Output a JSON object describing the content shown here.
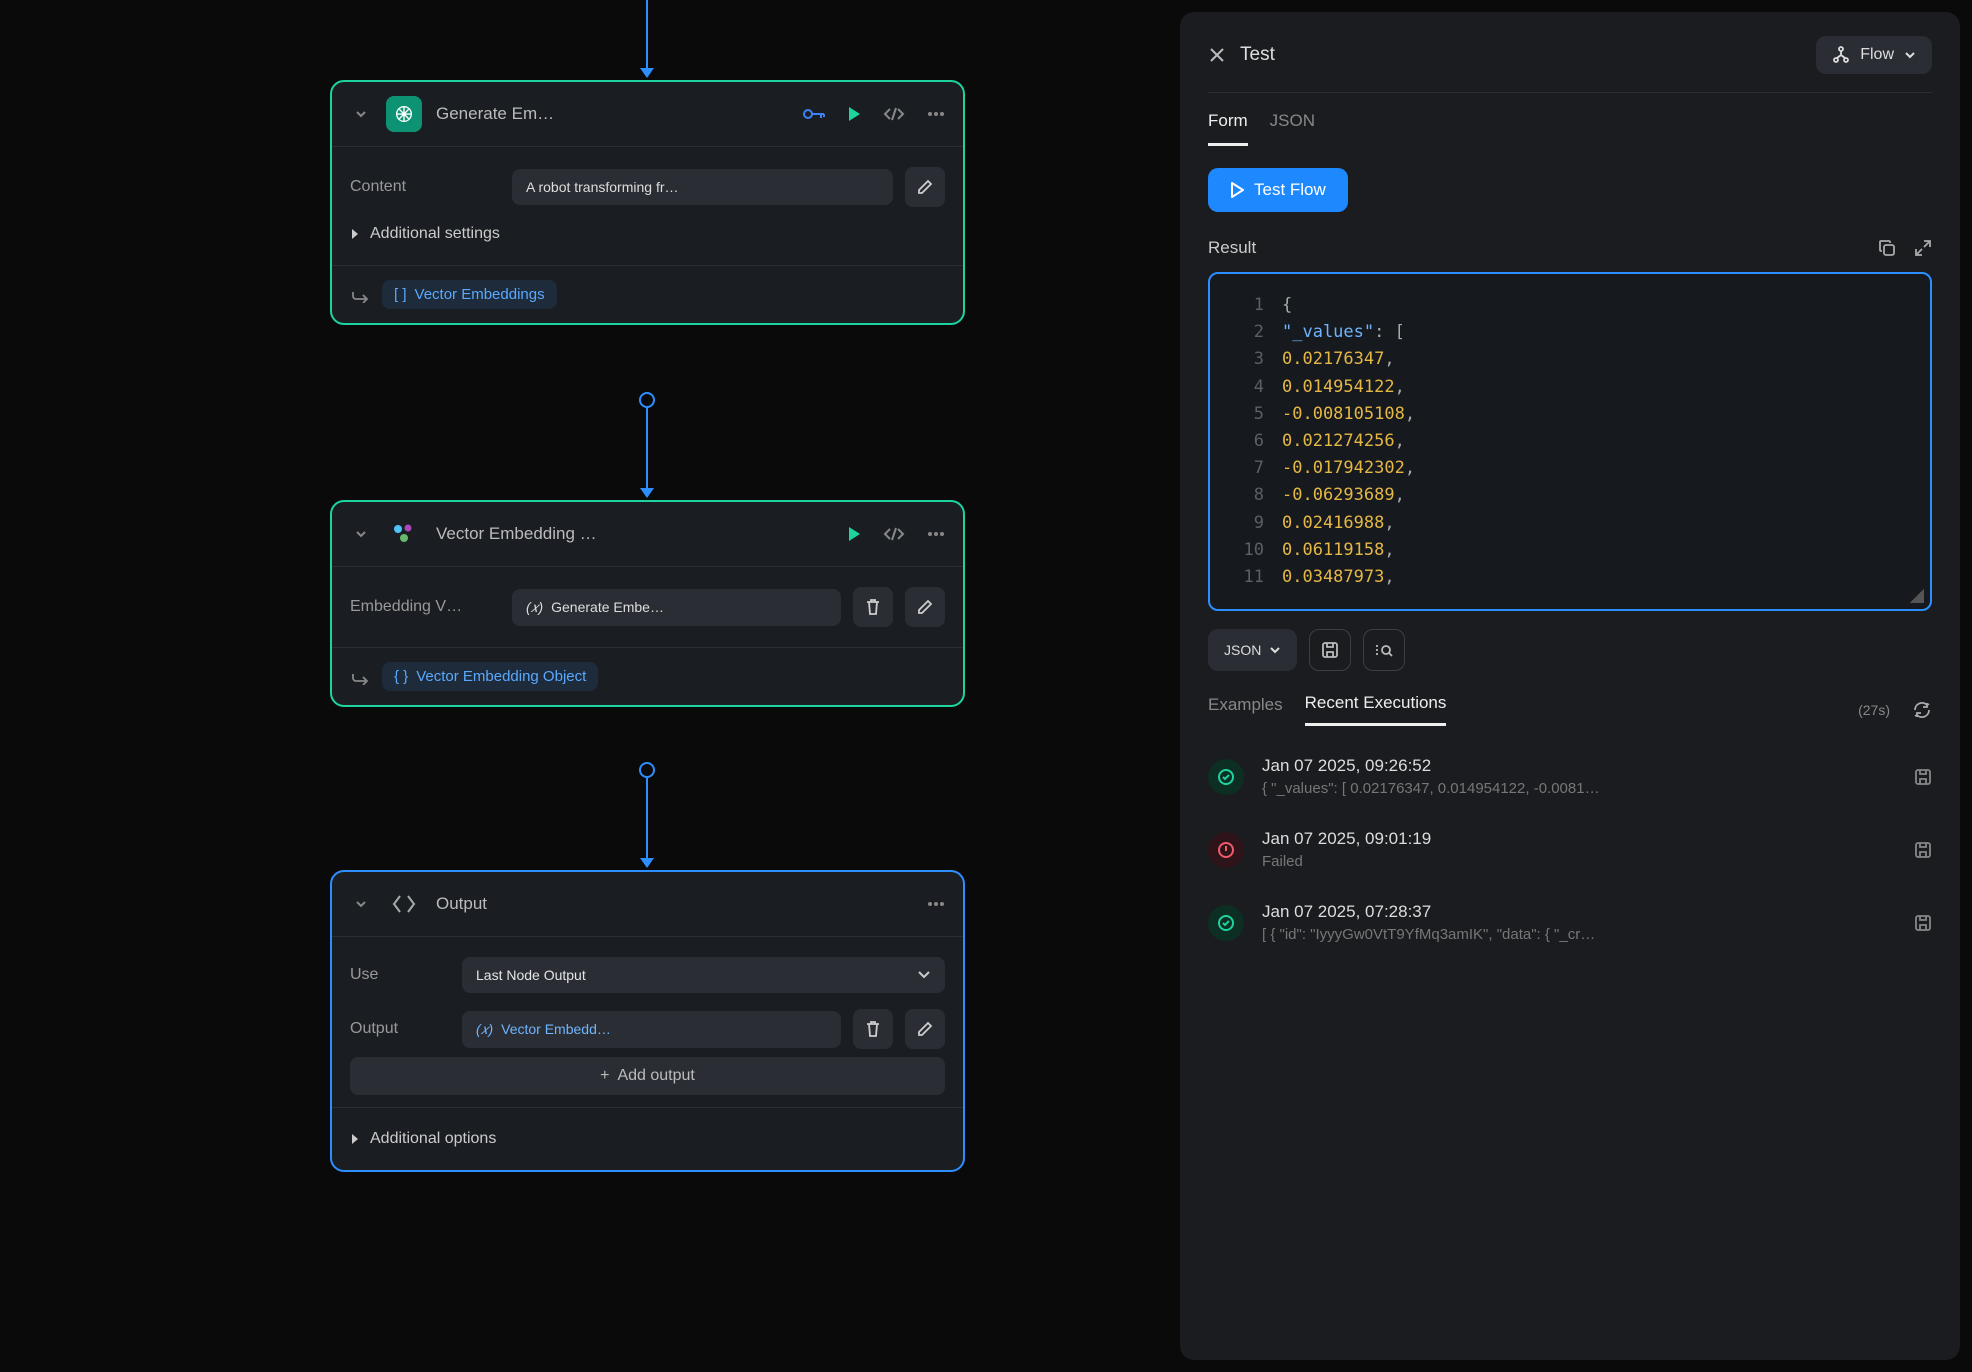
{
  "canvas": {
    "node1": {
      "title": "Generate Em…",
      "content_label": "Content",
      "content_value": "A robot transforming fr…",
      "additional": "Additional settings",
      "output_label": "Vector Embeddings"
    },
    "node2": {
      "title": "Vector Embedding …",
      "param_label": "Embedding V…",
      "param_value": "Generate Embe…",
      "output_label": "Vector Embedding Object"
    },
    "node3": {
      "title": "Output",
      "use_label": "Use",
      "use_value": "Last Node Output",
      "output_label": "Output",
      "output_value": "Vector Embedd…",
      "add_output": "Add output",
      "additional": "Additional options"
    }
  },
  "panel": {
    "title": "Test",
    "flow_btn": "Flow",
    "tabs": {
      "form": "Form",
      "json": "JSON"
    },
    "test_btn": "Test Flow",
    "result_label": "Result",
    "code": {
      "lines": [
        {
          "n": "1",
          "segs": [
            {
              "t": "{",
              "c": "punc"
            }
          ]
        },
        {
          "n": "2",
          "segs": [
            {
              "t": "  ",
              "c": "tok"
            },
            {
              "t": "\"_values\"",
              "c": "key-tok"
            },
            {
              "t": ": [",
              "c": "punc"
            }
          ]
        },
        {
          "n": "3",
          "segs": [
            {
              "t": "    ",
              "c": "tok"
            },
            {
              "t": "0.02176347",
              "c": "num-tok"
            },
            {
              "t": ",",
              "c": "punc"
            }
          ]
        },
        {
          "n": "4",
          "segs": [
            {
              "t": "    ",
              "c": "tok"
            },
            {
              "t": "0.014954122",
              "c": "num-tok"
            },
            {
              "t": ",",
              "c": "punc"
            }
          ]
        },
        {
          "n": "5",
          "segs": [
            {
              "t": "    ",
              "c": "tok"
            },
            {
              "t": "-0.008105108",
              "c": "num-tok"
            },
            {
              "t": ",",
              "c": "punc"
            }
          ]
        },
        {
          "n": "6",
          "segs": [
            {
              "t": "    ",
              "c": "tok"
            },
            {
              "t": "0.021274256",
              "c": "num-tok"
            },
            {
              "t": ",",
              "c": "punc"
            }
          ]
        },
        {
          "n": "7",
          "segs": [
            {
              "t": "    ",
              "c": "tok"
            },
            {
              "t": "-0.017942302",
              "c": "num-tok"
            },
            {
              "t": ",",
              "c": "punc"
            }
          ]
        },
        {
          "n": "8",
          "segs": [
            {
              "t": "    ",
              "c": "tok"
            },
            {
              "t": "-0.06293689",
              "c": "num-tok"
            },
            {
              "t": ",",
              "c": "punc"
            }
          ]
        },
        {
          "n": "9",
          "segs": [
            {
              "t": "    ",
              "c": "tok"
            },
            {
              "t": "0.02416988",
              "c": "num-tok"
            },
            {
              "t": ",",
              "c": "punc"
            }
          ]
        },
        {
          "n": "10",
          "segs": [
            {
              "t": "    ",
              "c": "tok"
            },
            {
              "t": "0.06119158",
              "c": "num-tok"
            },
            {
              "t": ",",
              "c": "punc"
            }
          ]
        },
        {
          "n": "11",
          "segs": [
            {
              "t": "    ",
              "c": "tok"
            },
            {
              "t": "0.03487973",
              "c": "num-tok"
            },
            {
              "t": ",",
              "c": "punc"
            }
          ]
        }
      ]
    },
    "format_btn": "JSON",
    "subtabs": {
      "examples": "Examples",
      "recent": "Recent Executions"
    },
    "age": "(27s)",
    "executions": [
      {
        "status": "ok",
        "ts": "Jan 07 2025, 09:26:52",
        "sub": "{ \"_values\": [ 0.02176347, 0.014954122, -0.0081…"
      },
      {
        "status": "fail",
        "ts": "Jan 07 2025, 09:01:19",
        "sub": "Failed"
      },
      {
        "status": "ok",
        "ts": "Jan 07 2025, 07:28:37",
        "sub": "[ { \"id\": \"IyyyGw0VtT9YfMq3amIK\", \"data\": { \"_cr…"
      }
    ]
  }
}
